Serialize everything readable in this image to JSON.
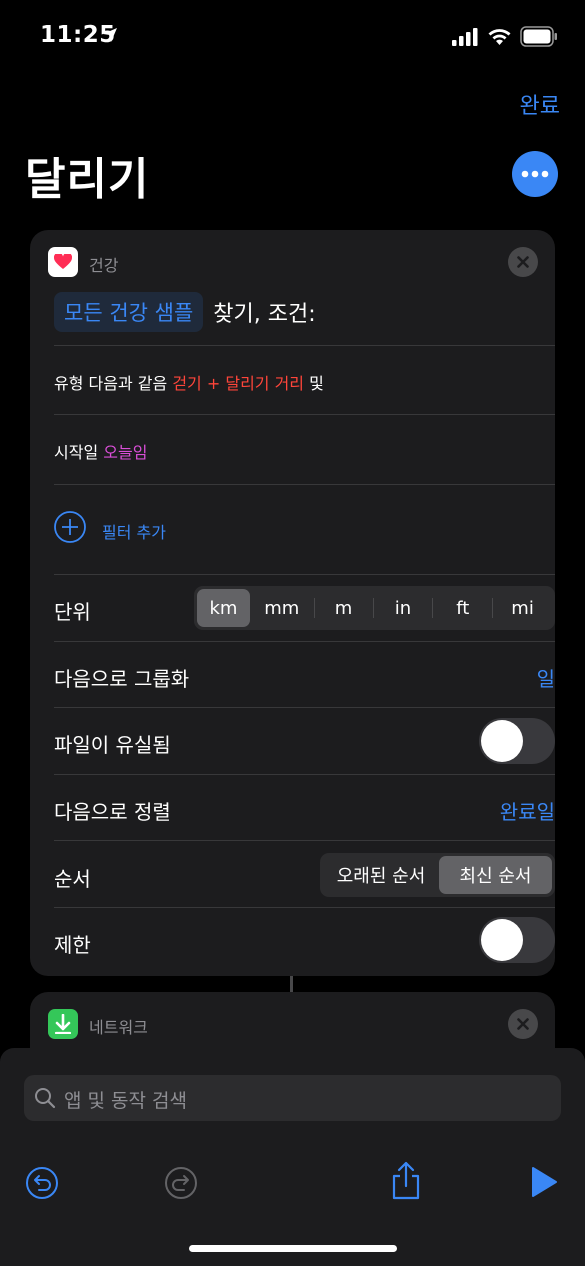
{
  "status_bar": {
    "time": "11:25"
  },
  "nav": {
    "done_label": "완료",
    "title": "달리기"
  },
  "health_action": {
    "app_label": "건강",
    "token": "모든 건강 샘플",
    "action_text": "찾기, 조건:",
    "filters": {
      "type_label": "유형",
      "type_op": "다음과 같음",
      "type_value": "걷기 + 달리기 거리",
      "type_and": "및",
      "start_label": "시작일",
      "start_value": "오늘임",
      "add_filter_label": "필터 추가"
    },
    "unit": {
      "label": "단위",
      "options": [
        "km",
        "mm",
        "m",
        "in",
        "ft",
        "mi"
      ],
      "selected": "km"
    },
    "group_by": {
      "label": "다음으로 그룹화",
      "value": "일"
    },
    "fill_missing": {
      "label": "파일이 유실됨",
      "on": false
    },
    "sort_by": {
      "label": "다음으로 정렬",
      "value": "완료일"
    },
    "order": {
      "label": "순서",
      "options": [
        "오래된 순서",
        "최신 순서"
      ],
      "selected": "최신 순서"
    },
    "limit": {
      "label": "제한",
      "on": false
    }
  },
  "network_action": {
    "app_label": "네트워크"
  },
  "search": {
    "placeholder": "앱 및 동작 검색"
  },
  "toolbar": {
    "undo_icon": "undo-icon",
    "redo_icon": "redo-icon",
    "share_icon": "share-icon",
    "run_icon": "play-icon"
  },
  "colors": {
    "accent": "#3a87f5",
    "variable_red": "#ff453a",
    "variable_pink": "#da4fd8",
    "card_bg": "#1c1c1e",
    "health_heart": "#ff2d55",
    "network_green": "#34c759"
  }
}
